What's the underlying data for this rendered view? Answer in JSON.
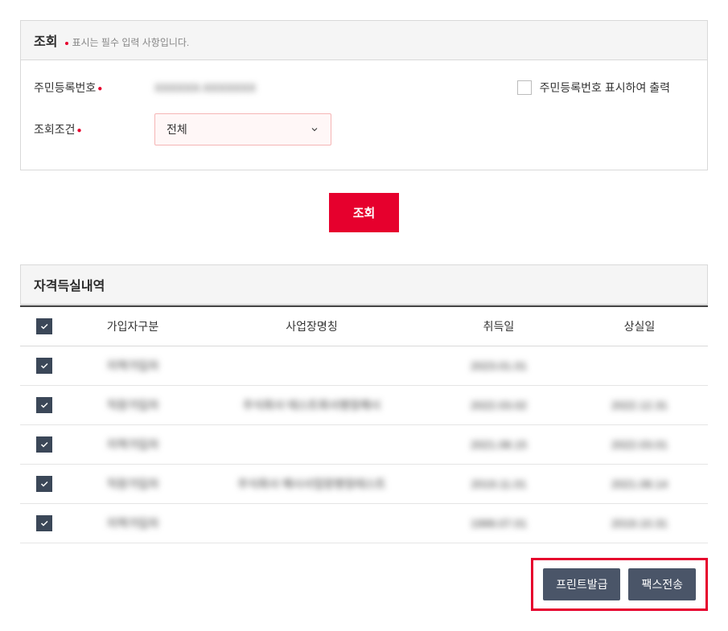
{
  "query_panel": {
    "title": "조회",
    "subtitle": "표시는 필수 입력 사항입니다.",
    "field_rrn": {
      "label": "주민등록번호",
      "value": "XXXXXX-XXXXXXX"
    },
    "field_cond": {
      "label": "조회조건",
      "selected": "전체"
    },
    "checkbox_label": "주민등록번호 표시하여 출력",
    "submit_label": "조회"
  },
  "result_panel": {
    "title": "자격득실내역",
    "columns": [
      "가입자구분",
      "사업장명칭",
      "취득일",
      "상실일"
    ],
    "rows": [
      {
        "c0": "지역가입자",
        "c1": "",
        "c2": "2023.01.01",
        "c3": ""
      },
      {
        "c0": "직장가입자",
        "c1": "주식회사 테스트회사명칭예시",
        "c2": "2022.03.02",
        "c3": "2022.12.31"
      },
      {
        "c0": "지역가입자",
        "c1": "",
        "c2": "2021.08.15",
        "c3": "2022.03.01"
      },
      {
        "c0": "직장가입자",
        "c1": "주식회사 예시사업장명칭테스트",
        "c2": "2019.11.01",
        "c3": "2021.08.14"
      },
      {
        "c0": "지역가입자",
        "c1": "",
        "c2": "1999.07.01",
        "c3": "2019.10.31"
      }
    ]
  },
  "actions": {
    "print": "프린트발급",
    "fax": "팩스전송"
  }
}
